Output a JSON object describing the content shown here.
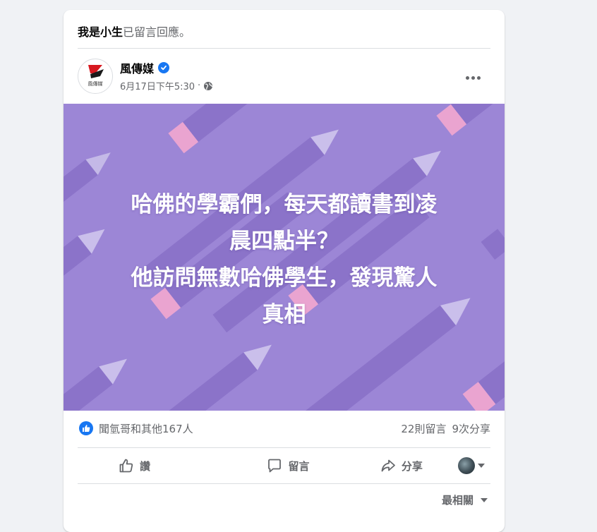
{
  "activity": {
    "user": "我是小生",
    "action": "已留言回應。"
  },
  "post": {
    "page_name": "風傳媒",
    "timestamp": "6月17日下午5:30",
    "separator": "·",
    "avatar_text": "風傳媒",
    "headline": "哈佛的學霸們，每天都讀書到凌\n晨四點半？\n他訪問無數哈佛學生，發現驚人\n真相"
  },
  "stats": {
    "reactions": "聞氫哥和其他167人",
    "comments": "22則留言",
    "shares": "9次分享"
  },
  "actions": {
    "like": "讚",
    "comment": "留言",
    "share": "分享"
  },
  "sort": {
    "label": "最相關"
  },
  "colors": {
    "image_bg": "#9c86d6",
    "accent": "#1877f2"
  }
}
